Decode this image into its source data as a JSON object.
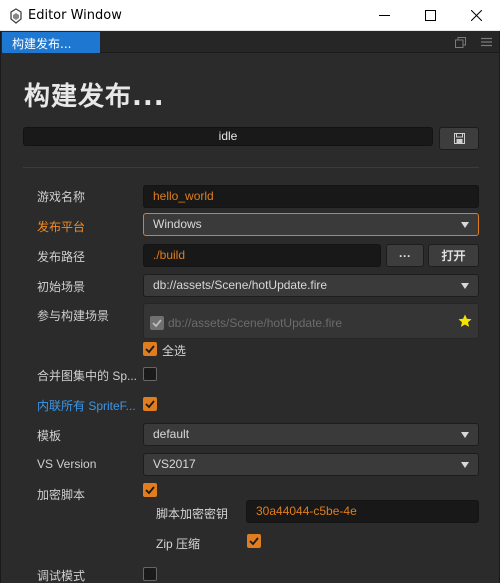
{
  "window": {
    "title": "Editor Window",
    "min_icon": "minimize-icon",
    "max_icon": "maximize-icon",
    "close_icon": "close-icon"
  },
  "tab": {
    "label": "构建发布...",
    "maximize_icon": "restore-panel-icon",
    "menu_icon": "panel-menu-icon"
  },
  "page": {
    "title": "构建发布..."
  },
  "progress": {
    "status": "idle",
    "value": 0
  },
  "form": {
    "game_name": {
      "label": "游戏名称",
      "value": "hello_world"
    },
    "platform": {
      "label": "发布平台",
      "value": "Windows"
    },
    "build_path": {
      "label": "发布路径",
      "value": "./build",
      "browse_label": "···",
      "open_label": "打开"
    },
    "start_scene": {
      "label": "初始场景",
      "value": "db://assets/Scene/hotUpdate.fire"
    },
    "included_scenes": {
      "label": "参与构建场景",
      "items": [
        "db://assets/Scene/hotUpdate.fire"
      ],
      "select_all_label": "全选"
    },
    "merge_atlas": {
      "label": "合并图集中的 Sp...",
      "checked": false
    },
    "inline_spriteframes": {
      "label": "内联所有 SpriteF...",
      "checked": true
    },
    "template": {
      "label": "模板",
      "value": "default"
    },
    "vs_version": {
      "label": "VS Version",
      "value": "VS2017"
    },
    "encrypt_js": {
      "label": "加密脚本",
      "checked": true
    },
    "encrypt_key": {
      "label": "脚本加密密钥",
      "value": "30a44044-c5be-4e"
    },
    "zip_compress": {
      "label": "Zip 压缩",
      "checked": true
    },
    "debug_mode": {
      "label": "调试模式",
      "checked": false
    }
  },
  "colors": {
    "accent": "#e07d1e",
    "tab_active": "#1e78d2",
    "panel_bg": "#2b2b2b",
    "link_blue": "#3c96e6"
  }
}
